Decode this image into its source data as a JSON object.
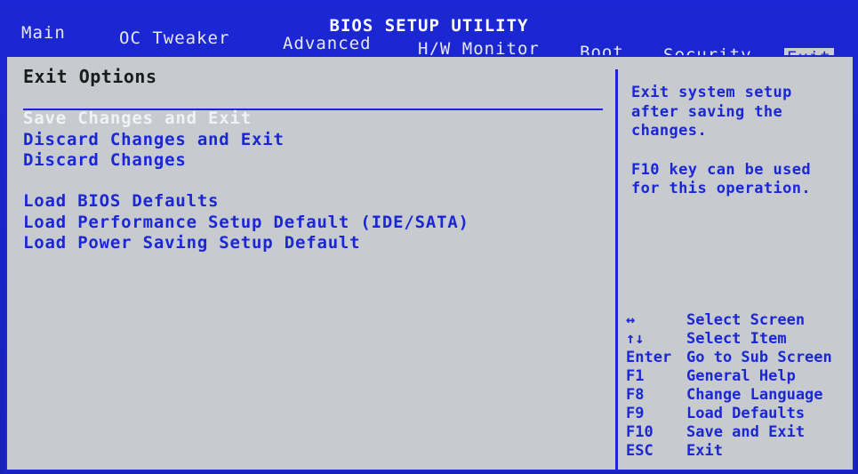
{
  "title": "BIOS SETUP UTILITY",
  "menu": [
    {
      "label": "Main"
    },
    {
      "label": "OC Tweaker"
    },
    {
      "label": "Advanced"
    },
    {
      "label": "H/W Monitor"
    },
    {
      "label": "Boot"
    },
    {
      "label": "Security"
    },
    {
      "label": "Exit",
      "active": true
    }
  ],
  "section_title": "Exit Options",
  "options": [
    {
      "label": "Save Changes and Exit",
      "selected": true
    },
    {
      "label": "Discard Changes and Exit"
    },
    {
      "label": "Discard Changes"
    },
    {
      "label": "Load BIOS Defaults"
    },
    {
      "label": "Load Performance Setup Default (IDE/SATA)"
    },
    {
      "label": "Load Power Saving Setup Default"
    }
  ],
  "help": {
    "line1": "Exit system setup",
    "line2": "after saving the",
    "line3": "changes.",
    "line4": "F10 key can be used",
    "line5": "for this operation."
  },
  "keys": [
    {
      "key": "↔",
      "desc": "Select Screen"
    },
    {
      "key": "↑↓",
      "desc": "Select Item"
    },
    {
      "key": "Enter",
      "desc": "Go to Sub Screen"
    },
    {
      "key": "F1",
      "desc": "General Help"
    },
    {
      "key": "F8",
      "desc": "Change Language"
    },
    {
      "key": "F9",
      "desc": "Load Defaults"
    },
    {
      "key": "F10",
      "desc": "Save and Exit"
    },
    {
      "key": "ESC",
      "desc": "Exit"
    }
  ],
  "colors": {
    "frame_blue": "#1b27d4",
    "panel_gray": "#c7cbcf",
    "selected_text": "#f1f2f4"
  }
}
